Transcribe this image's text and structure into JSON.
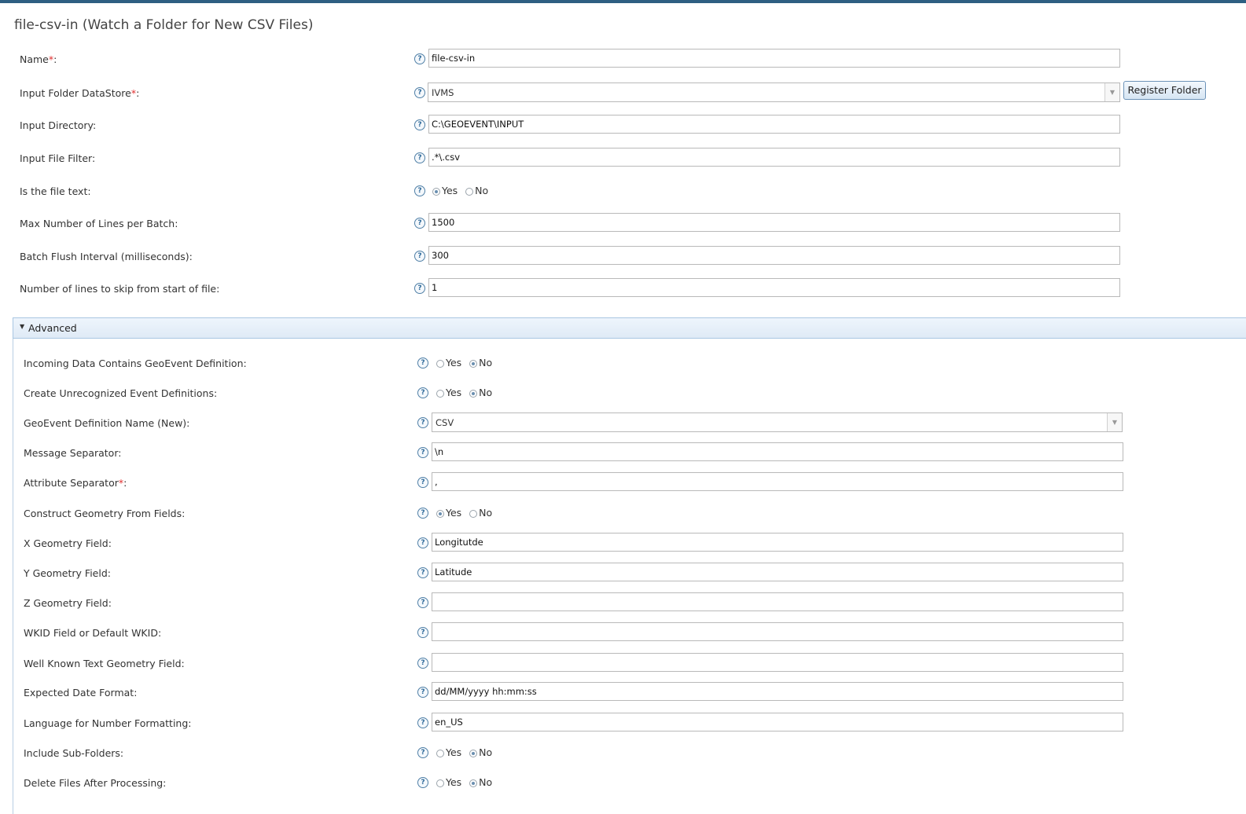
{
  "title": "file-csv-in (Watch a Folder for New CSV Files)",
  "help_glyph": "?",
  "required_mark": "*",
  "register_button": "Register Folder",
  "advanced_label": "Advanced",
  "radio_yes": "Yes",
  "radio_no": "No",
  "fields": {
    "name": {
      "label": "Name",
      "suffix": ":",
      "value": "file-csv-in"
    },
    "datastore": {
      "label": "Input Folder DataStore",
      "suffix": ":",
      "value": "IVMS"
    },
    "input_directory": {
      "label": "Input Directory:",
      "value": "C:\\GEOEVENT\\INPUT"
    },
    "input_file_filter": {
      "label": "Input File Filter:",
      "value": ".*\\.csv"
    },
    "is_text": {
      "label": "Is the file text:",
      "selected": "Yes"
    },
    "max_lines": {
      "label": "Max Number of Lines per Batch:",
      "value": "1500"
    },
    "flush_interval": {
      "label": "Batch Flush Interval (milliseconds):",
      "value": "300"
    },
    "skip_lines": {
      "label": "Number of lines to skip from start of file:",
      "value": "1"
    }
  },
  "advanced": {
    "incoming_def": {
      "label": "Incoming Data Contains GeoEvent Definition:",
      "selected": "No"
    },
    "create_unrecognized": {
      "label": "Create Unrecognized Event Definitions:",
      "selected": "No"
    },
    "def_name": {
      "label": "GeoEvent Definition Name (New):",
      "value": "CSV"
    },
    "msg_sep": {
      "label": "Message Separator:",
      "value": "\\n"
    },
    "attr_sep": {
      "label": "Attribute Separator",
      "suffix": ":",
      "value": ","
    },
    "construct_geom": {
      "label": "Construct Geometry From Fields:",
      "selected": "Yes"
    },
    "x_field": {
      "label": "X Geometry Field:",
      "value": "Longitutde"
    },
    "y_field": {
      "label": "Y Geometry Field:",
      "value": "Latitude"
    },
    "z_field": {
      "label": "Z Geometry Field:",
      "value": ""
    },
    "wkid": {
      "label": "WKID Field or Default WKID:",
      "value": ""
    },
    "wkt": {
      "label": "Well Known Text Geometry Field:",
      "value": ""
    },
    "date_format": {
      "label": "Expected Date Format:",
      "value": "dd/MM/yyyy hh:mm:ss"
    },
    "language": {
      "label": "Language for Number Formatting:",
      "value": "en_US"
    },
    "sub_folders": {
      "label": "Include Sub-Folders:",
      "selected": "No"
    },
    "delete_files": {
      "label": "Delete Files After Processing:",
      "selected": "No"
    }
  }
}
